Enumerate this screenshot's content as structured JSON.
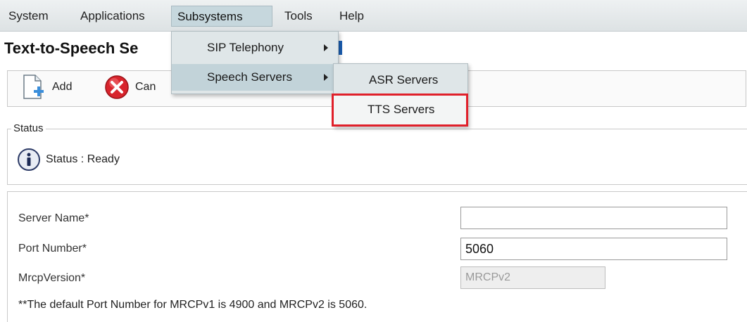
{
  "menubar": {
    "items": [
      "System",
      "Applications",
      "Subsystems",
      "Tools",
      "Help"
    ]
  },
  "page": {
    "title": "Text-to-Speech Se"
  },
  "toolbar": {
    "add_label": "Add",
    "cancel_label": "Can"
  },
  "subsystems_menu": {
    "items": [
      {
        "label": "SIP Telephony"
      },
      {
        "label": "Speech Servers"
      }
    ]
  },
  "speech_servers_menu": {
    "items": [
      {
        "label": "ASR Servers"
      },
      {
        "label": "TTS Servers"
      }
    ]
  },
  "status": {
    "legend": "Status",
    "text": "Status : Ready"
  },
  "form": {
    "server_name_label": "Server Name*",
    "server_name_value": "",
    "port_label": "Port Number*",
    "port_value": "5060",
    "mrcp_label": "MrcpVersion*",
    "mrcp_value": "MRCPv2",
    "note": "**The default Port Number for MRCPv1 is 4900 and MRCPv2 is 5060."
  },
  "colors": {
    "highlight": "#e0202a",
    "menu_active": "#c6d7dd"
  }
}
